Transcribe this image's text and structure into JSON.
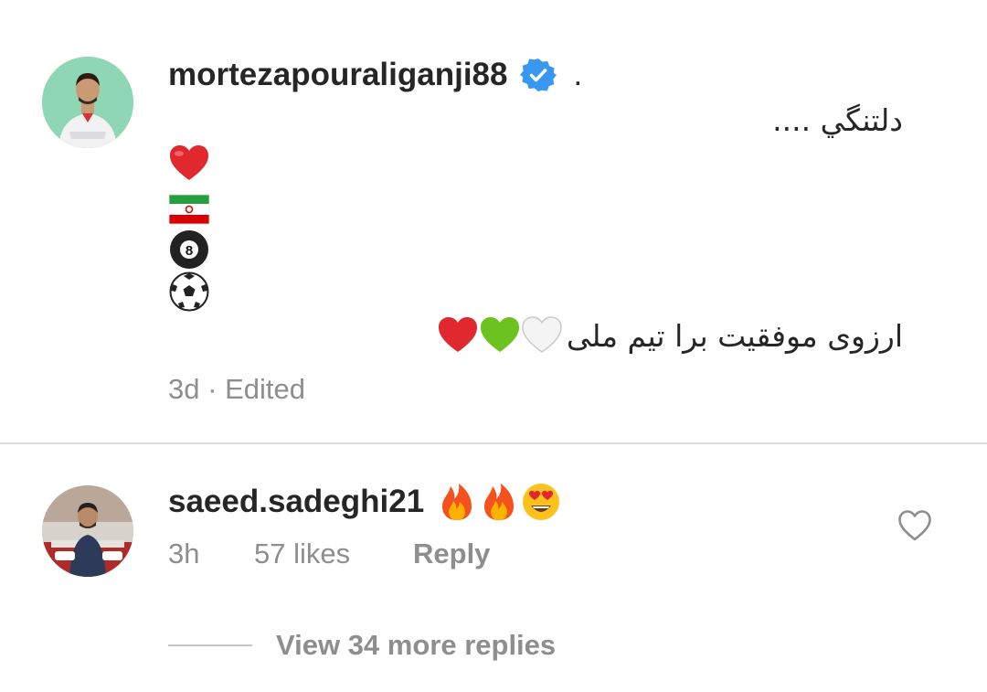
{
  "caption": {
    "username": "mortezapouraliganji88",
    "verified_icon": "verified-badge-icon",
    "trailing_dot": ".",
    "line_1": "دلتنگي ....",
    "emoji_lines": [
      "red-heart-emoji",
      "iran-flag-emoji",
      "8-ball-emoji",
      "soccer-ball-emoji"
    ],
    "line_2_text": "ارزوی موفقیت برا تیم ملی",
    "line_2_emojis": [
      "white-heart-emoji",
      "green-heart-emoji",
      "red-heart-emoji"
    ],
    "time": "3d",
    "separator": "·",
    "edited": "Edited"
  },
  "comment": {
    "username": "saeed.sadeghi21",
    "emojis": [
      "fire-emoji",
      "fire-emoji",
      "heart-eyes-emoji"
    ],
    "time": "3h",
    "likes": "57 likes",
    "reply_label": "Reply",
    "like_icon": "heart-outline-icon"
  },
  "view_replies": {
    "label": "View 34 more replies"
  },
  "colors": {
    "text_primary": "#262626",
    "text_secondary": "#8e8e8e",
    "divider": "#dbdbdb",
    "verified_blue": "#3897f0"
  }
}
